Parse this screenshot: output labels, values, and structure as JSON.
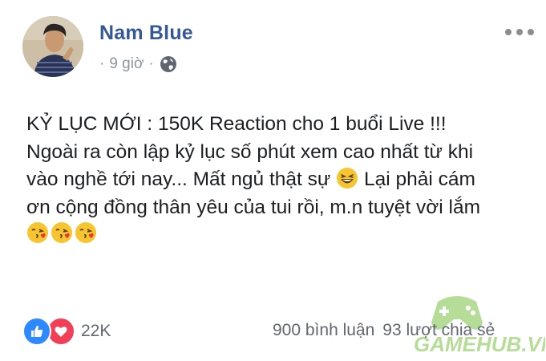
{
  "author": {
    "name": "Nam Blue",
    "time": "9 giờ",
    "privacy_icon": "globe-icon"
  },
  "post": {
    "lines": [
      "KỶ LỤC MỚI : 150K Reaction cho 1 buổi Live !!!",
      "Ngoài ra còn lập kỷ lục số phút xem cao nhất từ khi",
      "vào nghề tới nay... Mất ngủ thật sự",
      "Lại phải cám",
      "ơn cộng đồng thân yêu của tui rồi, m.n tuyệt vời lắm"
    ],
    "emojis": [
      "laughing-emoji",
      "kiss-emoji",
      "kiss-emoji",
      "kiss-emoji"
    ]
  },
  "footer": {
    "reaction_icons": [
      "like-icon",
      "love-icon"
    ],
    "reaction_count": "22K",
    "comments": "900 bình luận",
    "shares": "93 lượt chia sẻ"
  },
  "watermark": {
    "text": "GAMEHUB.VN",
    "color": "#7cc243"
  },
  "colors": {
    "name": "#365899",
    "meta": "#8d949e",
    "like": "#2e89ff",
    "love": "#f33e58"
  }
}
